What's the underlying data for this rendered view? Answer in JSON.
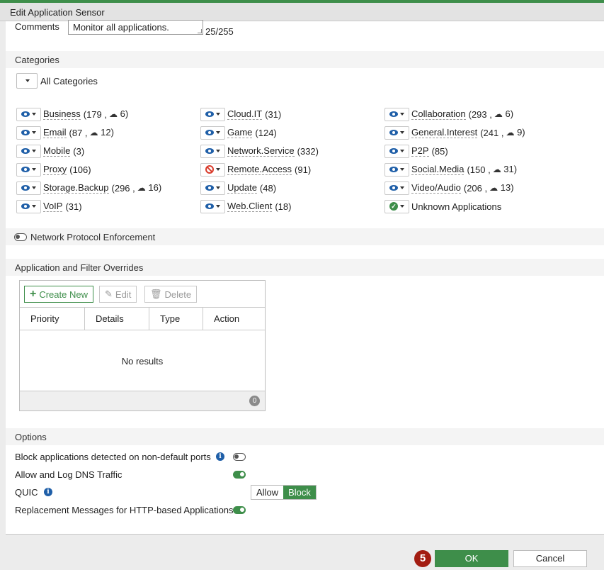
{
  "dialog": {
    "title": "Edit Application Sensor"
  },
  "comments": {
    "label": "Comments",
    "value": "Monitor all applications.",
    "count": "25/255"
  },
  "categories": {
    "header": "Categories",
    "filter_label": "All Categories",
    "items": [
      {
        "name": "Business",
        "count": "(179 ,",
        "cloud": "6)",
        "action": "monitor"
      },
      {
        "name": "Cloud.IT",
        "count": "(31)",
        "cloud": "",
        "action": "monitor"
      },
      {
        "name": "Collaboration",
        "count": "(293 ,",
        "cloud": "6)",
        "action": "monitor"
      },
      {
        "name": "Email",
        "count": "(87 ,",
        "cloud": "12)",
        "action": "monitor"
      },
      {
        "name": "Game",
        "count": "(124)",
        "cloud": "",
        "action": "monitor"
      },
      {
        "name": "General.Interest",
        "count": "(241 ,",
        "cloud": "9)",
        "action": "monitor"
      },
      {
        "name": "Mobile",
        "count": "(3)",
        "cloud": "",
        "action": "monitor"
      },
      {
        "name": "Network.Service",
        "count": "(332)",
        "cloud": "",
        "action": "monitor"
      },
      {
        "name": "P2P",
        "count": "(85)",
        "cloud": "",
        "action": "monitor"
      },
      {
        "name": "Proxy",
        "count": "(106)",
        "cloud": "",
        "action": "monitor"
      },
      {
        "name": "Remote.Access",
        "count": "(91)",
        "cloud": "",
        "action": "block"
      },
      {
        "name": "Social.Media",
        "count": "(150 ,",
        "cloud": "31)",
        "action": "monitor"
      },
      {
        "name": "Storage.Backup",
        "count": "(296 ,",
        "cloud": "16)",
        "action": "monitor"
      },
      {
        "name": "Update",
        "count": "(48)",
        "cloud": "",
        "action": "monitor"
      },
      {
        "name": "Video/Audio",
        "count": "(206 ,",
        "cloud": "13)",
        "action": "monitor"
      },
      {
        "name": "VoIP",
        "count": "(31)",
        "cloud": "",
        "action": "monitor"
      },
      {
        "name": "Web.Client",
        "count": "(18)",
        "cloud": "",
        "action": "monitor"
      },
      {
        "name": "Unknown Applications",
        "count": "",
        "cloud": "",
        "action": "allow"
      }
    ]
  },
  "network_protocol": {
    "label": "Network Protocol Enforcement",
    "enabled": false
  },
  "overrides": {
    "header": "Application and Filter Overrides",
    "create_new": "Create New",
    "edit": "Edit",
    "delete": "Delete",
    "columns": [
      "Priority",
      "Details",
      "Type",
      "Action"
    ],
    "empty_text": "No results",
    "total": "0"
  },
  "options": {
    "header": "Options",
    "block_nondefault": {
      "label": "Block applications detected on non-default ports",
      "enabled": false
    },
    "allow_dns": {
      "label": "Allow and Log DNS Traffic",
      "enabled": true
    },
    "quic": {
      "label": "QUIC",
      "allow": "Allow",
      "block": "Block",
      "selected": "Block"
    },
    "replacement_msgs": {
      "label": "Replacement Messages for HTTP-based Applications",
      "enabled": true
    }
  },
  "footer": {
    "step": "5",
    "ok": "OK",
    "cancel": "Cancel"
  },
  "colors": {
    "accent": "#3e8e4a",
    "monitor": "#1f5fa8",
    "block": "#d93b2b",
    "step": "#a31d12"
  }
}
